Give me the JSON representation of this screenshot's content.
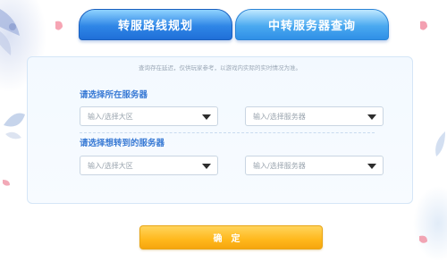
{
  "tabs": [
    {
      "label": "转服路线规划",
      "active": true
    },
    {
      "label": "中转服务器查询",
      "active": false
    }
  ],
  "notice": "查询存在延迟，仅供玩家参考，以游戏内实际的实时情况为准。",
  "sections": [
    {
      "label": "请选择所在服务器",
      "region_placeholder": "输入/选择大区",
      "server_placeholder": "输入/选择服务器"
    },
    {
      "label": "请选择想转到的服务器",
      "region_placeholder": "输入/选择大区",
      "server_placeholder": "输入/选择服务器"
    }
  ],
  "confirm_label": "确定",
  "colors": {
    "tab_active": "#2f86e6",
    "tab_inactive": "#4aa9f0",
    "label": "#3a7bd5",
    "confirm": "#ffb81c"
  }
}
